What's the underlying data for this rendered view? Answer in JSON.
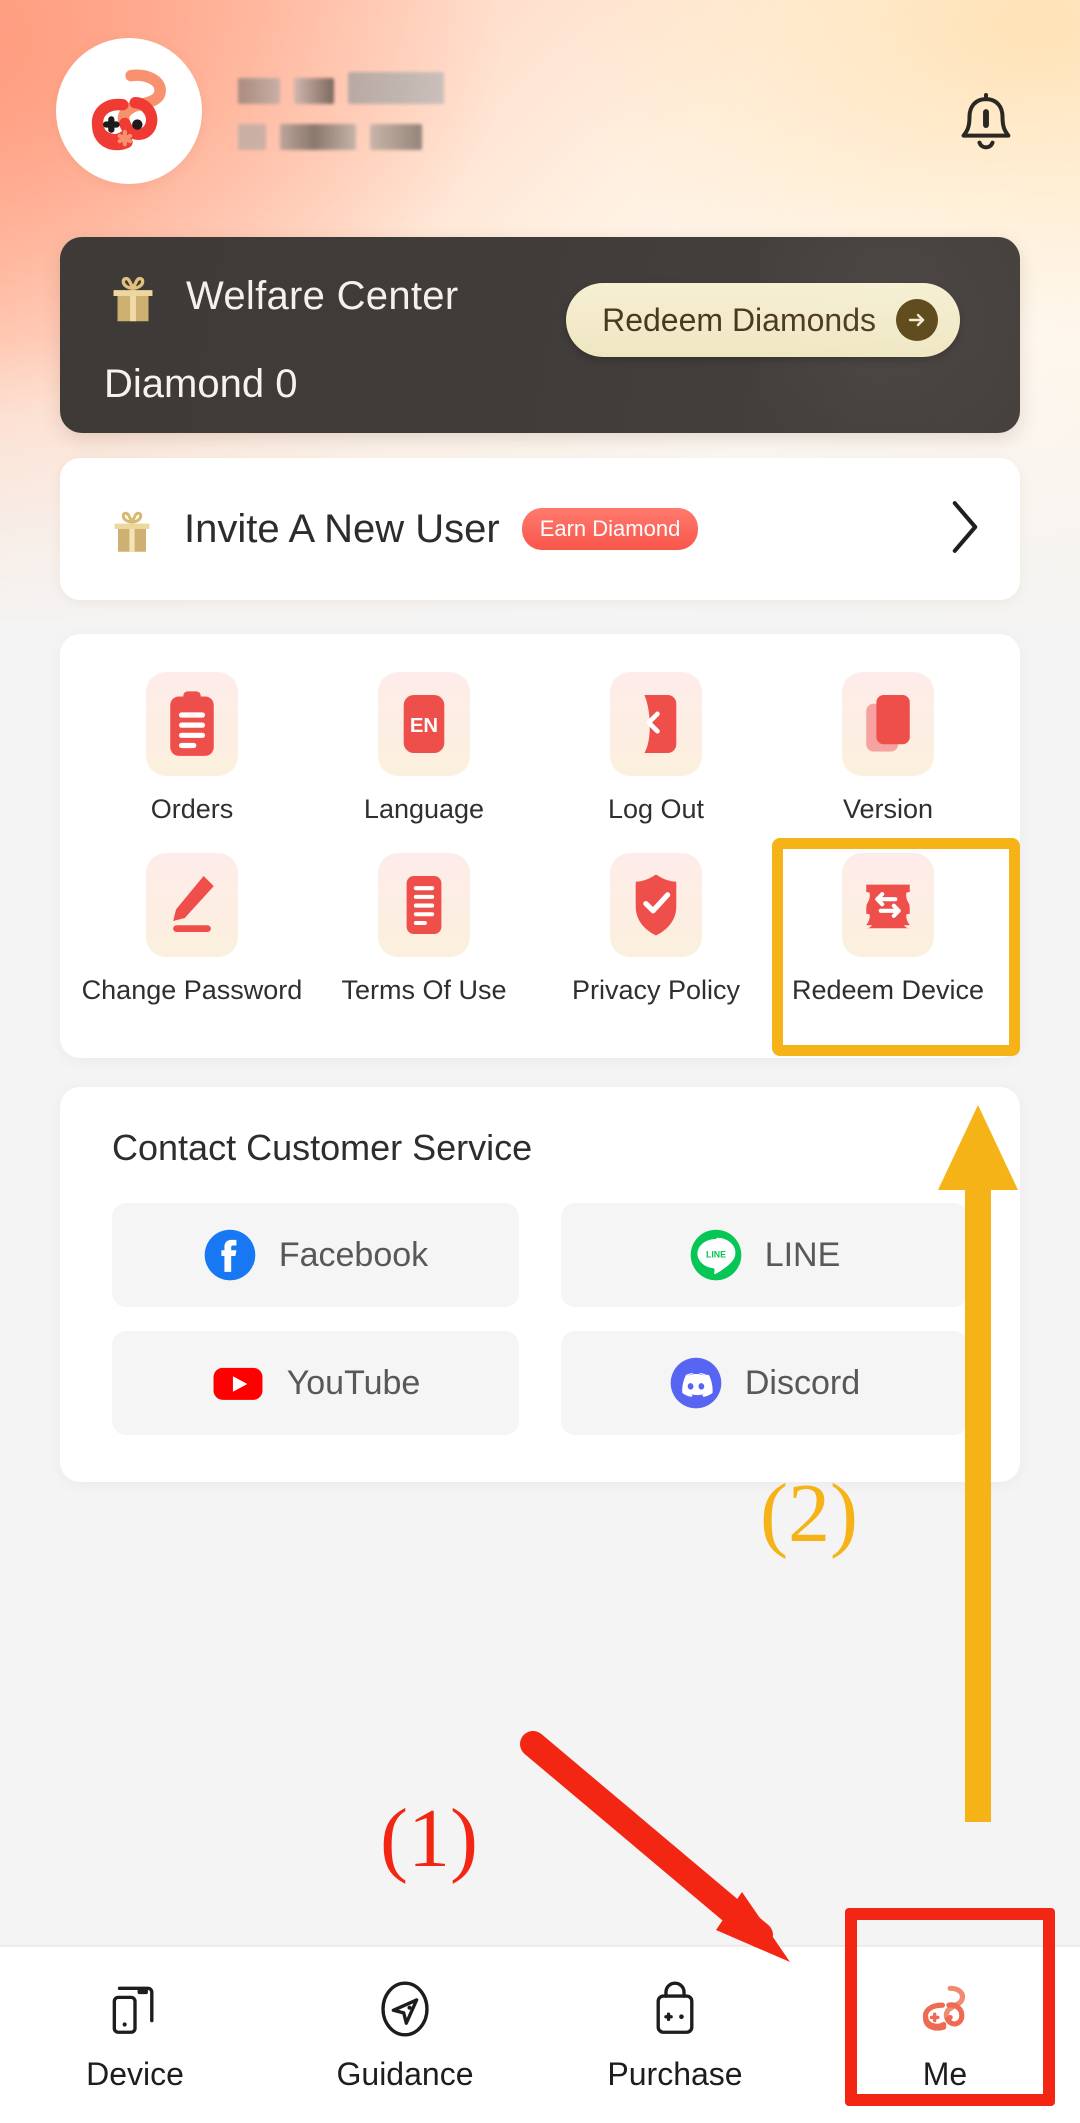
{
  "app": {
    "brand_logo": "snake-mascot-logo",
    "accent_red": "#f0514a",
    "accent_gold": "#F5B317",
    "highlight_red": "#F22613",
    "banner_dark": "#3f3b39"
  },
  "header": {
    "avatar_icon": "snake-mascot-avatar",
    "username_redacted": true,
    "notification_icon": "bell-alert-icon"
  },
  "welfare": {
    "gift_icon": "gift-box-icon",
    "title": "Welfare Center",
    "diamond_label": "Diamond 0",
    "redeem_button": "Redeem Diamonds",
    "redeem_arrow_icon": "arrow-right-circle-icon"
  },
  "invite": {
    "gift_icon": "gift-box-icon",
    "label": "Invite A New User",
    "badge": "Earn Diamond",
    "chevron_icon": "chevron-right-icon"
  },
  "menu_grid": [
    {
      "label": "Orders",
      "icon": "clipboard-list-icon",
      "highlighted": false
    },
    {
      "label": "Language",
      "icon": "language-en-icon",
      "highlighted": false
    },
    {
      "label": "Log Out",
      "icon": "logout-icon",
      "highlighted": false
    },
    {
      "label": "Version",
      "icon": "layers-stack-icon",
      "highlighted": false
    },
    {
      "label": "Change Password",
      "icon": "pencil-edit-icon",
      "highlighted": false
    },
    {
      "label": "Terms Of Use",
      "icon": "document-lines-icon",
      "highlighted": false
    },
    {
      "label": "Privacy Policy",
      "icon": "shield-check-icon",
      "highlighted": false
    },
    {
      "label": "Redeem Device",
      "icon": "ticket-swap-icon",
      "highlighted": true
    }
  ],
  "contact": {
    "title": "Contact Customer Service",
    "channels": [
      {
        "label": "Facebook",
        "icon": "facebook-icon",
        "color": "#1877F2"
      },
      {
        "label": "LINE",
        "icon": "line-icon",
        "color": "#06C755"
      },
      {
        "label": "YouTube",
        "icon": "youtube-icon",
        "color": "#FF0000"
      },
      {
        "label": "Discord",
        "icon": "discord-icon",
        "color": "#5865F2"
      }
    ]
  },
  "bottom_nav": {
    "items": [
      {
        "label": "Device",
        "icon": "phone-device-icon",
        "active": false
      },
      {
        "label": "Guidance",
        "icon": "compass-send-icon",
        "active": false
      },
      {
        "label": "Purchase",
        "icon": "shopping-bag-icon",
        "active": false
      },
      {
        "label": "Me",
        "icon": "snake-mascot-icon",
        "active": true
      }
    ]
  },
  "annotations": {
    "step_one": "(1)",
    "step_two": "(2)",
    "step_one_color": "#F22613",
    "step_two_color": "#F5B317",
    "red_arrow": "arrow-to-me-tab",
    "gold_arrow": "arrow-to-redeem-device",
    "red_box_target": "Me",
    "gold_box_target": "Redeem Device"
  }
}
